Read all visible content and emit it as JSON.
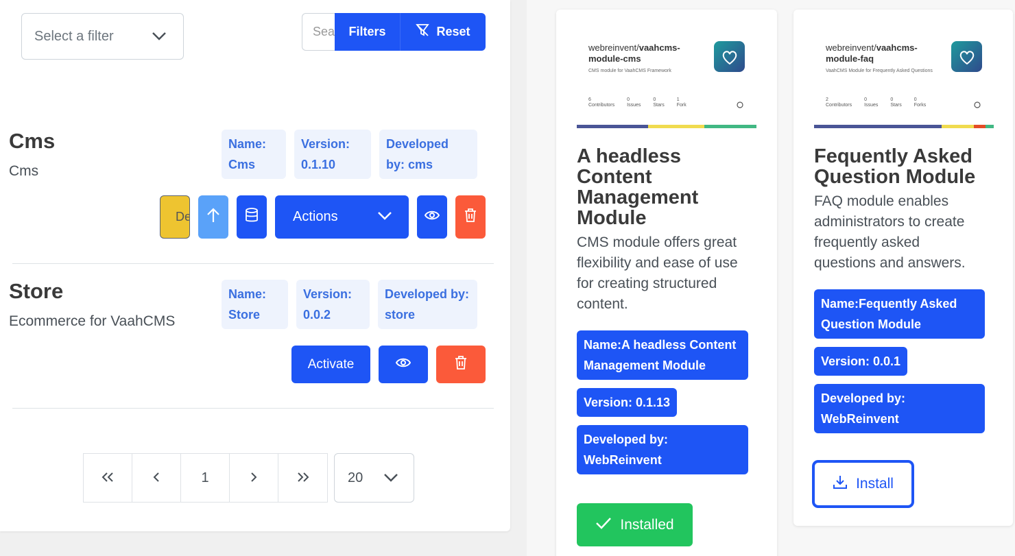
{
  "filter": {
    "placeholder": "Select a filter"
  },
  "search": {
    "placeholder": "Search"
  },
  "toolbar": {
    "filters_label": "Filters",
    "reset_label": "Reset"
  },
  "modules": [
    {
      "title": "Cms",
      "description": "Cms",
      "tags": [
        "Name: Cms",
        "Version: 0.1.10",
        "Developed by: cms"
      ],
      "tag_lines": [
        [
          "Name:",
          "Cms"
        ],
        [
          "Version:",
          "0.1.10"
        ],
        [
          "Developed",
          "by: cms"
        ]
      ],
      "deactivate_label": "Deactivate",
      "actions_label": "Actions"
    },
    {
      "title": "Store",
      "description": "Ecommerce for VaahCMS",
      "tag_lines": [
        [
          "Name:",
          "Store"
        ],
        [
          "Version:",
          "0.0.2"
        ],
        [
          "Developed by:",
          "store"
        ]
      ],
      "activate_label": "Activate"
    }
  ],
  "pagination": {
    "current_page": "1",
    "rows_per_page": "20"
  },
  "cards": [
    {
      "image": {
        "org": "webreinvent/",
        "repo_line1": "vaahcms-",
        "repo_line2": "module-cms",
        "subtitle": "CMS module for VaahCMS Framework",
        "stats": [
          [
            "6",
            "Contributors"
          ],
          [
            "0",
            "Issues"
          ],
          [
            "0",
            "Stars"
          ],
          [
            "1",
            "Fork"
          ]
        ]
      },
      "title_lines": [
        "A headless",
        "Content",
        "Management",
        "Module"
      ],
      "desc_lines": [
        "CMS module offers great",
        "flexibility and ease of use",
        "for creating structured",
        "content."
      ],
      "name_lines": [
        "Name:A headless Content",
        "Management Module"
      ],
      "version": "Version: 0.1.13",
      "dev_lines": [
        "Developed by:",
        "WebReinvent"
      ],
      "button_label": "Installed"
    },
    {
      "image": {
        "org": "webreinvent/",
        "repo_line1": "vaahcms-",
        "repo_line2": "module-faq",
        "subtitle": "VaahCMS Module for Frequently Asked Questions",
        "stats": [
          [
            "2",
            "Contributors"
          ],
          [
            "0",
            "Issues"
          ],
          [
            "0",
            "Stars"
          ],
          [
            "0",
            "Forks"
          ]
        ]
      },
      "title_lines": [
        "Fequently Asked",
        "Question Module"
      ],
      "desc_lines": [
        "FAQ module enables",
        "administrators to create",
        "frequently asked",
        "questions and answers."
      ],
      "name_lines": [
        "Name:Fequently Asked",
        "Question Module"
      ],
      "version": "Version: 0.0.1",
      "dev_lines": [
        "Developed by:",
        "WebReinvent"
      ],
      "button_label": "Install"
    }
  ],
  "colors": {
    "primary": "#1e55f5",
    "danger": "#fb5a3a",
    "success": "#22c55e",
    "warning": "#eec430",
    "info": "#5aa2f9"
  }
}
